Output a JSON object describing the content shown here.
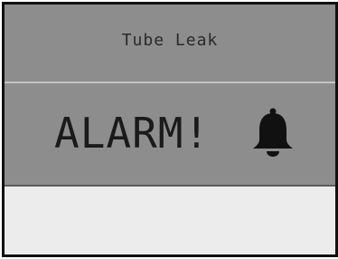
{
  "header": {
    "title": "Tube Leak"
  },
  "alarm": {
    "label": "ALARM!",
    "icon": "bell-icon"
  },
  "colors": {
    "panel": "#8d8d8d",
    "text": "#1a1a1a",
    "background": "#ececec",
    "frame": "#111111"
  }
}
